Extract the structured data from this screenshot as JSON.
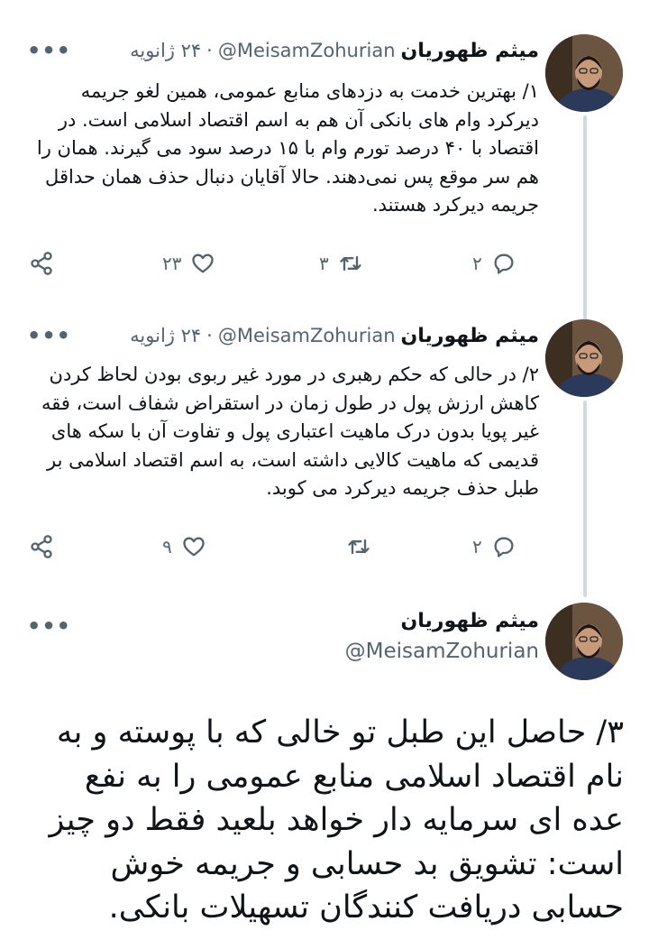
{
  "tweets": [
    {
      "author_name": "میثم ظهوریان",
      "handle": "@MeisamZohurian",
      "dot": "·",
      "date": "۲۴ ژانویه",
      "more": "•••",
      "text": "۱/ بهترین خدمت به دزدهای منابع عمومی، همین لغو جریمه دیرکرد وام های بانکی آن هم به اسم اقتصاد اسلامی است. در اقتصاد با ۴۰ درصد تورم وام با ۱۵ درصد سود می گیرند. همان را هم سر موقع پس نمی‌دهند. حالا آقایان دنبال حذف همان حداقل جریمه دیرکرد هستند.",
      "reply_count": "۲",
      "retweet_count": "۳",
      "like_count": "۲۳"
    },
    {
      "author_name": "میثم ظهوریان",
      "handle": "@MeisamZohurian",
      "dot": "·",
      "date": "۲۴ ژانویه",
      "more": "•••",
      "text": "۲/ در حالی که حکم رهبری در مورد غیر ربوی بودن لحاظ کردن کاهش ارزش پول در طول زمان در استقراض شفاف است، فقه غیر پویا بدون درک  ماهیت اعتباری پول و تفاوت آن با سکه های قدیمی که ماهیت کالایی داشته است، به اسم اقتصاد اسلامی بر طبل حذف جریمه دیرکرد می کوبد.",
      "reply_count": "۲",
      "retweet_count": "",
      "like_count": "۹"
    }
  ],
  "main_tweet": {
    "author_name": "میثم ظهوریان",
    "handle": "@MeisamZohurian",
    "more": "•••",
    "text": "۳/ حاصل این طبل تو خالی که با پوسته و به نام اقتصاد اسلامی منابع عمومی را به نفع عده ای سرمایه دار خواهد بلعید فقط دو چیز است: تشویق بد حسابی و جریمه خوش حسابی دریافت کنندگان تسهیلات بانکی."
  },
  "icons": {
    "reply": "reply-icon",
    "retweet": "retweet-icon",
    "like": "heart-icon",
    "share": "share-icon",
    "more": "more-icon"
  },
  "colors": {
    "text": "#0f1419",
    "secondary": "#536471",
    "thread_line": "#cfd9de"
  }
}
